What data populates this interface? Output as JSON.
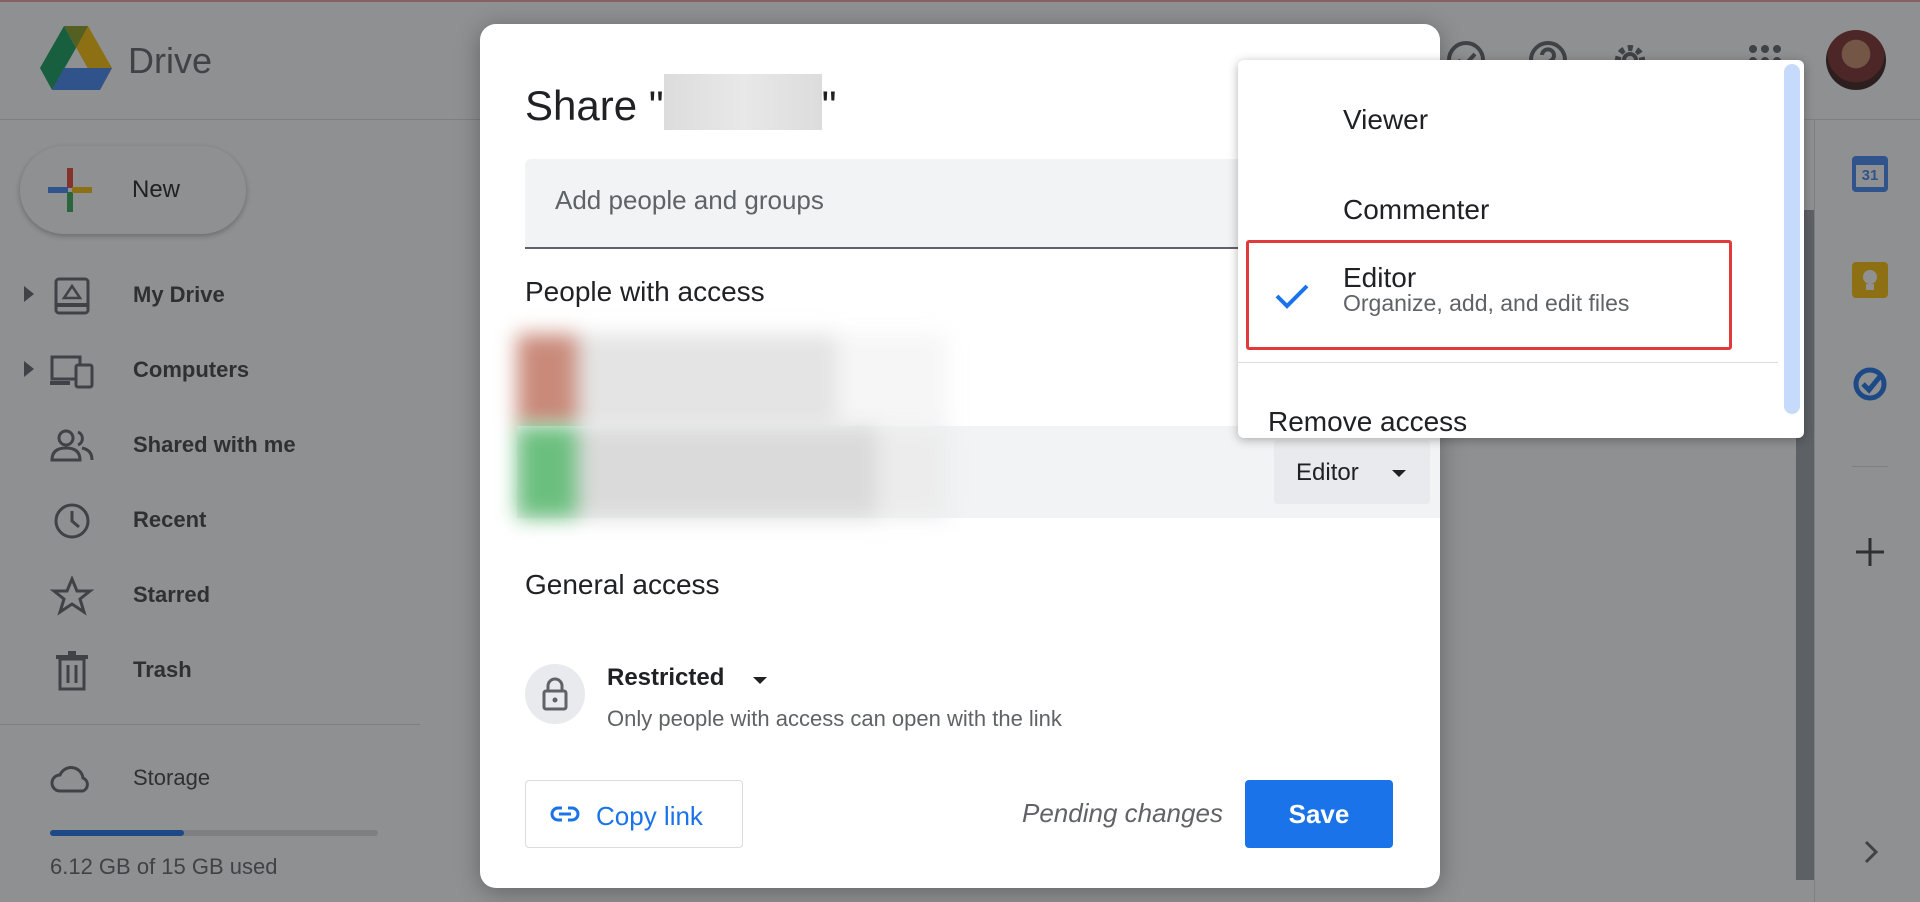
{
  "app": {
    "name": "Drive"
  },
  "sidebar": {
    "new_label": "New",
    "items": [
      {
        "label": "My Drive",
        "icon": "my-drive-icon"
      },
      {
        "label": "Computers",
        "icon": "computers-icon"
      },
      {
        "label": "Shared with me",
        "icon": "shared-with-me-icon"
      },
      {
        "label": "Recent",
        "icon": "clock-icon"
      },
      {
        "label": "Starred",
        "icon": "star-icon"
      },
      {
        "label": "Trash",
        "icon": "trash-icon"
      }
    ],
    "storage": {
      "label": "Storage",
      "used_text": "6.12 GB of 15 GB used",
      "used_fraction": 0.408
    }
  },
  "right_panel": {
    "calendar_day": "31"
  },
  "share_dialog": {
    "title_prefix": "Share \"",
    "title_suffix": "\"",
    "add_placeholder": "Add people and groups",
    "people_heading": "People with access",
    "people": [
      {
        "role": ""
      },
      {
        "role": "Editor"
      }
    ],
    "general_access_heading": "General access",
    "access_level": "Restricted",
    "access_description": "Only people with access can open with the link",
    "copy_link_label": "Copy link",
    "pending_text": "Pending changes",
    "save_label": "Save"
  },
  "role_menu": {
    "items": [
      {
        "label": "Viewer"
      },
      {
        "label": "Commenter"
      },
      {
        "label": "Editor",
        "description": "Organize, add, and edit files",
        "selected": true
      }
    ],
    "remove_label": "Remove access"
  },
  "colors": {
    "accent": "#1a73e8",
    "highlight_border": "#e03a3a"
  }
}
